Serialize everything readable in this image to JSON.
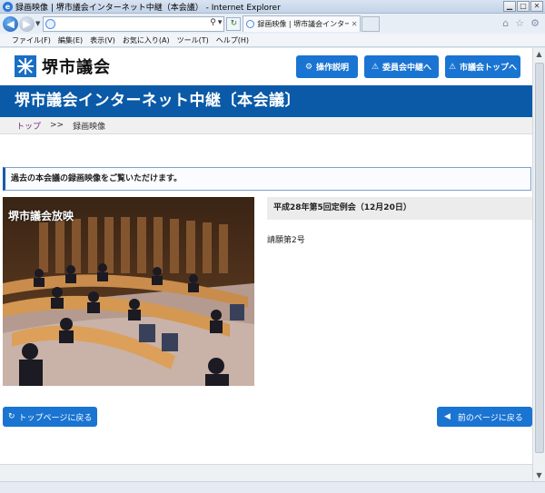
{
  "window": {
    "title": "録画映像 | 堺市議会インターネット中継（本会議） - Internet Explorer"
  },
  "browser": {
    "address_value": "",
    "tab_label": "録画映像 | 堺市議会インター...",
    "menu": [
      "ファイル(F)",
      "編集(E)",
      "表示(V)",
      "お気に入り(A)",
      "ツール(T)",
      "ヘルプ(H)"
    ]
  },
  "site": {
    "logo_text": "堺市議会",
    "buttons": {
      "manual": "操作説明",
      "committee": "委員会中継へ",
      "council_top": "市議会トップへ"
    },
    "banner_title": "堺市議会インターネット中継〔本会議〕"
  },
  "breadcrumb": {
    "top": "トップ",
    "separator": ">>",
    "current": "録画映像"
  },
  "notice": "過去の本会議の録画映像をご覧いただけます。",
  "video": {
    "overlay_text": "堺市議会放映"
  },
  "meeting": {
    "session": "平成28年第5回定例会（12月20日）",
    "agenda_item": "請願第2号"
  },
  "nav": {
    "back_top": "トップページに戻る",
    "back_prev": "前のページに戻る"
  },
  "colors": {
    "primary_blue": "#1a74d2",
    "banner_blue": "#0a5aa8",
    "breadcrumb_link": "#7a2f7a"
  }
}
